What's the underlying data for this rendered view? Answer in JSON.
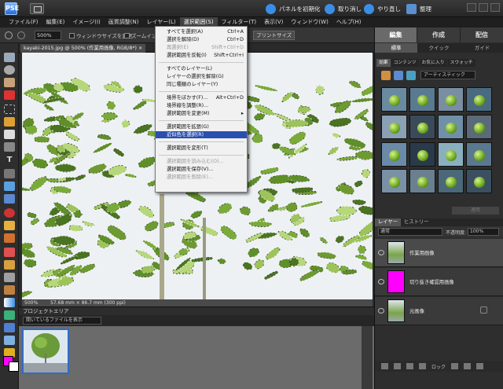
{
  "appbar": {
    "logo": "PSE",
    "reset_panels": "パネルを初期化",
    "undo": "取り消し",
    "redo": "やり直し",
    "organize": "整理"
  },
  "menubar": [
    "ファイル(F)",
    "編集(E)",
    "イメージ(I)",
    "画質調整(N)",
    "レイヤー(L)",
    "選択範囲(S)",
    "フィルター(T)",
    "表示(V)",
    "ウィンドウ(W)",
    "ヘルプ(H)"
  ],
  "options": {
    "zoom": "500%",
    "resize_window": "ウィンドウサイズを変更",
    "zoom_all": "ズームインデスク",
    "print_size": "プリントサイズ"
  },
  "doc_tab": "kayaki-2015.jpg @ 500% (作業用画像, RGB/8*) ×",
  "status": {
    "zoom": "500%",
    "dims": "57.68 mm × 86.7 mm (300 ppi)"
  },
  "bin": {
    "title": "プロジェクトエリア",
    "select": "開いているファイルを表示"
  },
  "dropdown": [
    {
      "label": "すべてを選択(A)",
      "shortcut": "Ctrl+A",
      "enabled": true
    },
    {
      "label": "選択を解除(D)",
      "shortcut": "Ctrl+D",
      "enabled": true
    },
    {
      "label": "再選択(E)",
      "shortcut": "Shift+Ctrl+D",
      "enabled": false
    },
    {
      "label": "選択範囲を反転(I)",
      "shortcut": "Shift+Ctrl+I",
      "enabled": true
    },
    {
      "sep": true
    },
    {
      "label": "すべてのレイヤー(L)",
      "shortcut": "",
      "enabled": true
    },
    {
      "label": "レイヤーの選択を解除(G)",
      "shortcut": "",
      "enabled": true
    },
    {
      "label": "同じ種類のレイヤー(Y)",
      "shortcut": "",
      "enabled": true
    },
    {
      "sep": true
    },
    {
      "label": "境界をぼかす(F)...",
      "shortcut": "Alt+Ctrl+D",
      "enabled": true
    },
    {
      "label": "境界線を調整(R)...",
      "shortcut": "",
      "enabled": true
    },
    {
      "label": "選択範囲を変更(M)",
      "shortcut": "▸",
      "enabled": true
    },
    {
      "sep": true
    },
    {
      "label": "選択範囲を拡張(G)",
      "shortcut": "",
      "enabled": true
    },
    {
      "label": "近似色を選択(R)",
      "shortcut": "",
      "enabled": true,
      "highlight": true
    },
    {
      "sep": true
    },
    {
      "label": "選択範囲を変形(T)",
      "shortcut": "",
      "enabled": true
    },
    {
      "sep": true
    },
    {
      "label": "選択範囲を読み込む(O)...",
      "shortcut": "",
      "enabled": false
    },
    {
      "label": "選択範囲を保存(V)...",
      "shortcut": "",
      "enabled": true
    },
    {
      "label": "選択範囲を削除(E)...",
      "shortcut": "",
      "enabled": false
    }
  ],
  "panel": {
    "main_tabs": [
      "編集",
      "作成",
      "配信"
    ],
    "sub_tabs": [
      "標準",
      "クイック",
      "ガイド"
    ],
    "effect_tabs": [
      "効果",
      "コンテンツ",
      "お気に入り",
      "スウォッチ"
    ],
    "effect_select": "アーティスティック",
    "apply": "適用",
    "layer_tabs": [
      "レイヤー",
      "ヒストリー"
    ],
    "blend": "通常",
    "opacity_label": "不透明度:",
    "opacity": "100%",
    "layers": [
      {
        "name": "作業用画像",
        "thumb": "photo",
        "selected": true
      },
      {
        "name": "切り抜き確認用画像",
        "thumb": "magenta",
        "selected": false
      },
      {
        "name": "元画像",
        "thumb": "photo",
        "selected": false,
        "locked": true
      }
    ],
    "lock_label": "ロック"
  },
  "colors": {
    "foreground": "#ff00ff",
    "background": "#ffffff",
    "highlight": "#2b4fb0"
  }
}
